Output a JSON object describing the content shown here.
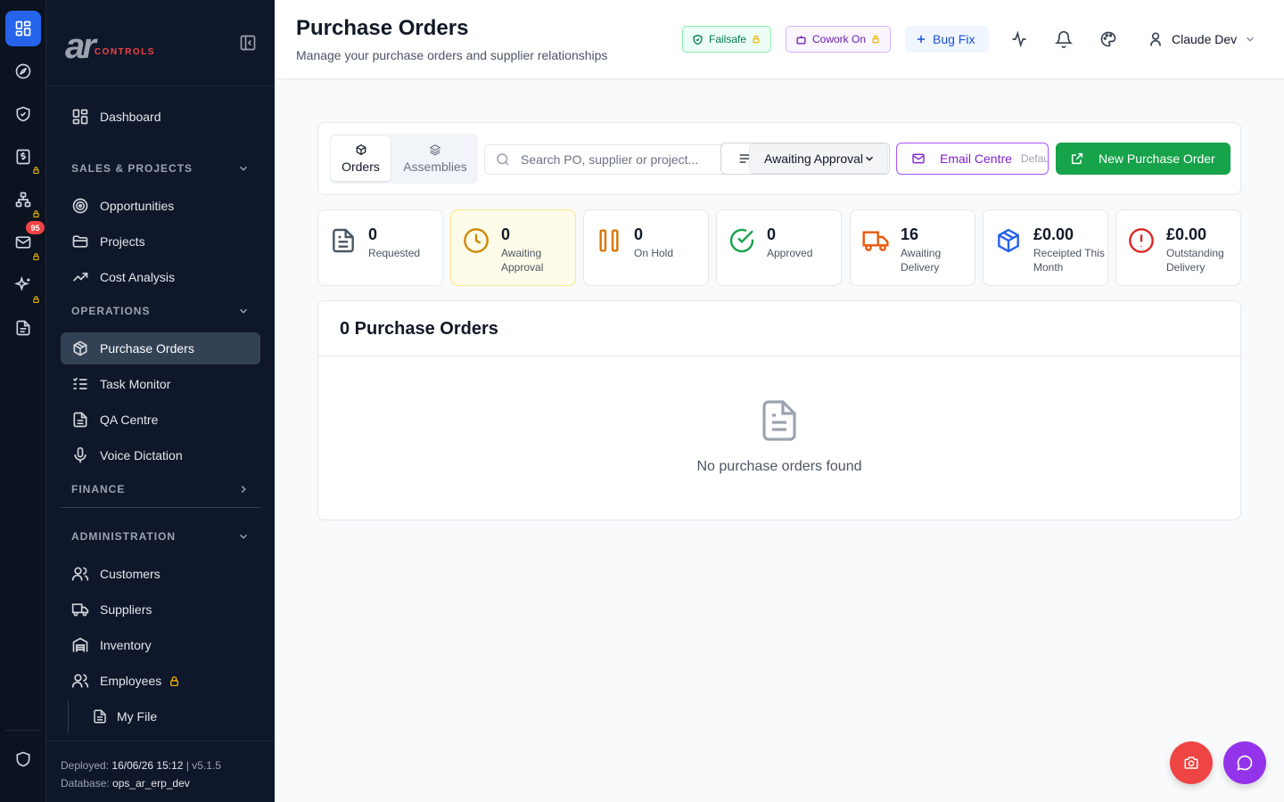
{
  "rail": {
    "badge_count": "95"
  },
  "sidebar": {
    "logo_main": "ar",
    "logo_sub": "CONTROLS",
    "dashboard": "Dashboard",
    "sections": {
      "sales": "SALES & PROJECTS",
      "operations": "OPERATIONS",
      "finance": "FINANCE",
      "administration": "ADMINISTRATION"
    },
    "items": {
      "opportunities": "Opportunities",
      "projects": "Projects",
      "cost_analysis": "Cost Analysis",
      "purchase_orders": "Purchase Orders",
      "task_monitor": "Task Monitor",
      "qa_centre": "QA Centre",
      "voice_dictation": "Voice Dictation",
      "customers": "Customers",
      "suppliers": "Suppliers",
      "inventory": "Inventory",
      "employees": "Employees",
      "my_file": "My File"
    },
    "footer": {
      "deployed_label": "Deployed:",
      "deployed_value": "16/06/26 15:12",
      "separator": "|",
      "version": "v5.1.5",
      "database_label": "Database:",
      "database_value": "ops_ar_erp_dev"
    }
  },
  "header": {
    "title": "Purchase Orders",
    "subtitle": "Manage your purchase orders and supplier relationships",
    "failsafe": "Failsafe",
    "cowork": "Cowork On",
    "bug_fix": "Bug Fix",
    "user_name": "Claude Dev"
  },
  "toolbar": {
    "tab_orders": "Orders",
    "tab_assemblies": "Assemblies",
    "search_placeholder": "Search PO, supplier or project...",
    "filter_value": "Awaiting Approval",
    "email_label": "Email Centre",
    "email_sub": "Default",
    "new_po": "New Purchase Order"
  },
  "stats": [
    {
      "value": "0",
      "label": "Requested"
    },
    {
      "value": "0",
      "label": "Awaiting Approval"
    },
    {
      "value": "0",
      "label": "On Hold"
    },
    {
      "value": "0",
      "label": "Approved"
    },
    {
      "value": "16",
      "label": "Awaiting Delivery"
    },
    {
      "value": "£0.00",
      "label": "Receipted This Month"
    },
    {
      "value": "£0.00",
      "label": "Outstanding Delivery"
    }
  ],
  "list": {
    "title": "0 Purchase Orders",
    "empty_text": "No purchase orders found"
  },
  "colors": {
    "accent_blue": "#2563eb",
    "primary_green": "#16a34a",
    "awaiting_amber": "#ca8a04",
    "on_hold_orange": "#d97706",
    "approved_green": "#16a34a",
    "delivery_orange": "#ea580c",
    "receipted_blue": "#2563eb",
    "outstanding_red": "#dc2626",
    "chat_purple": "#9333ea",
    "camera_red": "#ef4444"
  }
}
